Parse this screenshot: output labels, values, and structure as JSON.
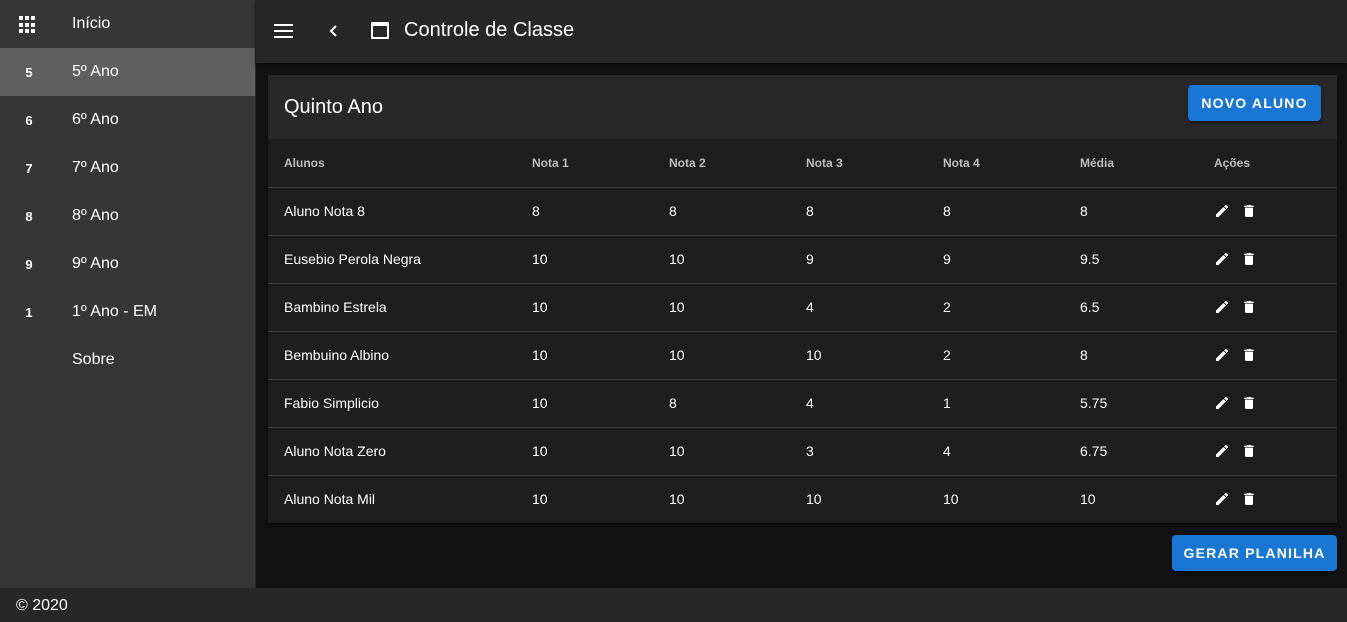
{
  "sidebar": {
    "items": [
      {
        "icon": "apps-grid-icon",
        "badge": "",
        "label": "Início"
      },
      {
        "icon": "",
        "badge": "5",
        "label": "5º Ano"
      },
      {
        "icon": "",
        "badge": "6",
        "label": "6º Ano"
      },
      {
        "icon": "",
        "badge": "7",
        "label": "7º Ano"
      },
      {
        "icon": "",
        "badge": "8",
        "label": "8º Ano"
      },
      {
        "icon": "",
        "badge": "9",
        "label": "9º Ano"
      },
      {
        "icon": "",
        "badge": "1",
        "label": "1º Ano - EM"
      },
      {
        "icon": "",
        "badge": "",
        "label": "Sobre"
      }
    ],
    "active_index": 1
  },
  "appbar": {
    "title": "Controle de Classe"
  },
  "card": {
    "title": "Quinto Ano",
    "new_button": "NOVO ALUNO",
    "columns": [
      "Alunos",
      "Nota 1",
      "Nota 2",
      "Nota 3",
      "Nota 4",
      "Média",
      "Ações"
    ],
    "rows": [
      [
        "Aluno Nota 8",
        "8",
        "8",
        "8",
        "8",
        "8"
      ],
      [
        "Eusebio Perola Negra",
        "10",
        "10",
        "9",
        "9",
        "9.5"
      ],
      [
        "Bambino Estrela",
        "10",
        "10",
        "4",
        "2",
        "6.5"
      ],
      [
        "Bembuino Albino",
        "10",
        "10",
        "10",
        "2",
        "8"
      ],
      [
        "Fabio Simplicio",
        "10",
        "8",
        "4",
        "1",
        "5.75"
      ],
      [
        "Aluno Nota Zero",
        "10",
        "10",
        "3",
        "4",
        "6.75"
      ],
      [
        "Aluno Nota Mil",
        "10",
        "10",
        "10",
        "10",
        "10"
      ]
    ]
  },
  "export_button": "GERAR PLANILHA",
  "footer": {
    "text": "© 2020"
  },
  "colors": {
    "primary": "#1976d2",
    "sidebar_bg": "#363636",
    "sidebar_active": "#5f5f5f",
    "appbar_bg": "#272727",
    "page_bg": "#121212",
    "card_bg": "#1e1e1e"
  }
}
